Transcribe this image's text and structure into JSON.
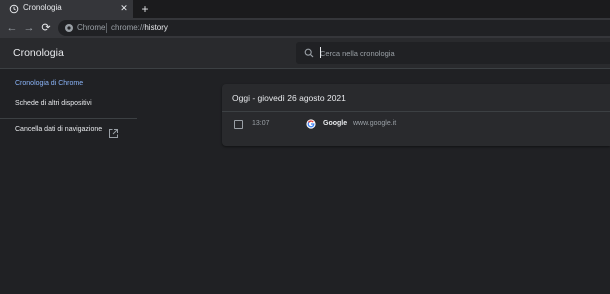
{
  "browser": {
    "tab": {
      "title": "Cronologia",
      "close_glyph": "✕"
    },
    "new_tab_glyph": "+",
    "nav": {
      "back_glyph": "←",
      "forward_glyph": "→",
      "reload_glyph": "⟳"
    },
    "omnibox": {
      "chip": "Chrome",
      "url_scheme": "chrome://",
      "url_path": "history"
    }
  },
  "header": {
    "title": "Cronologia",
    "search_placeholder": "Cerca nella cronologia"
  },
  "sidebar": {
    "items": [
      {
        "label": "Cronologia di Chrome",
        "selected": true
      },
      {
        "label": "Schede di altri dispositivi",
        "selected": false
      }
    ],
    "clear_label": "Cancella dati di navigazione"
  },
  "history": {
    "day_heading": "Oggi - giovedì 26 agosto 2021",
    "entries": [
      {
        "time": "13:07",
        "title": "Google",
        "domain": "www.google.it"
      }
    ]
  },
  "colors": {
    "background": "#202124",
    "surface": "#292a2d",
    "accent": "#8ab4f8",
    "text": "#e8eaed",
    "muted_text": "#9aa0a6"
  }
}
